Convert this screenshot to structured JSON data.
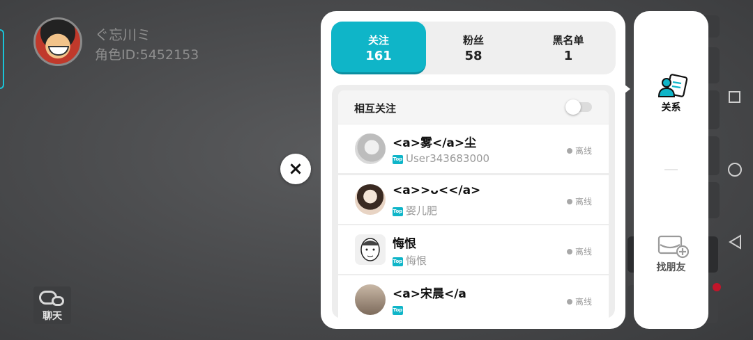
{
  "profile": {
    "name": "ぐ忘川ミ",
    "role_id": "角色ID:5452153"
  },
  "chat_button": {
    "label": "聊天"
  },
  "close_button": {
    "label": "×"
  },
  "tabs": [
    {
      "label": "关注",
      "count": "161",
      "active": true
    },
    {
      "label": "粉丝",
      "count": "58",
      "active": false
    },
    {
      "label": "黑名单",
      "count": "1",
      "active": false
    }
  ],
  "mutual_follow": {
    "label": "相互关注",
    "enabled": false
  },
  "friends": [
    {
      "name": "<a>雾</a>尘",
      "subtitle": "User343683000",
      "badge": "Top",
      "status": "离线"
    },
    {
      "name": "<a>>ᴗ<</a>",
      "subtitle": "婴儿肥",
      "badge": "Top",
      "status": "离线"
    },
    {
      "name": "悔恨",
      "subtitle": "悔恨",
      "badge": "Top",
      "status": "离线"
    },
    {
      "name": "<a>宋晨</a",
      "subtitle": "",
      "badge": "Top",
      "status": "离线"
    }
  ],
  "side_menu": {
    "relations_label": "关系",
    "find_friends_label": "找朋友"
  },
  "colors": {
    "accent": "#0fb5c8",
    "panel": "#ffffff",
    "background": "#4a4b4d",
    "offline_dot": "#a8a8a8"
  }
}
